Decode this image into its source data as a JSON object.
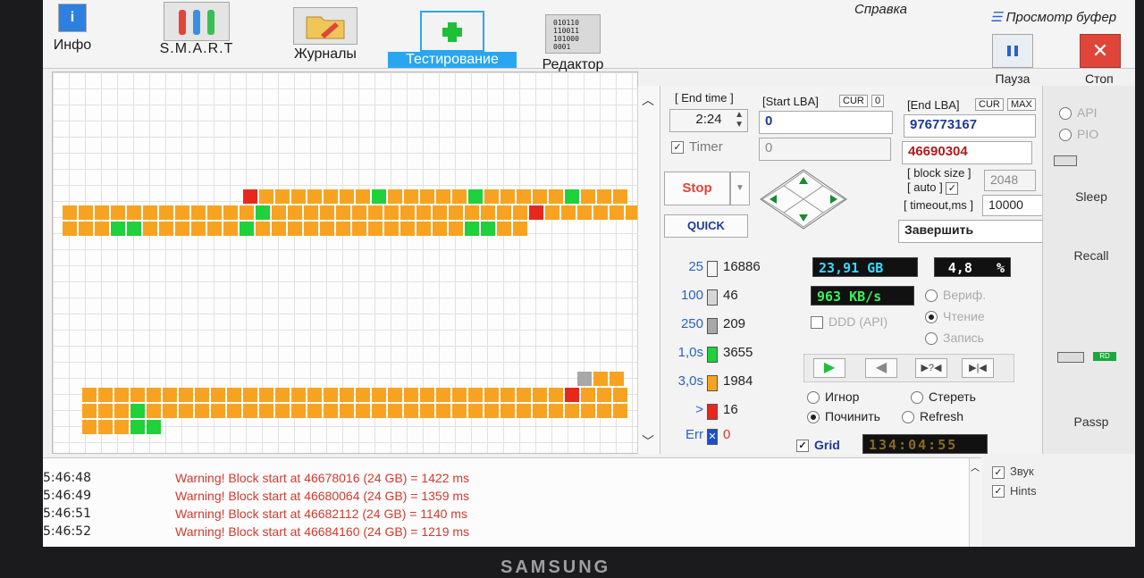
{
  "toolbar": {
    "info": "Инфо",
    "smart": "S.M.A.R.T",
    "journals": "Журналы",
    "testing": "Тестирование",
    "editor": "Редактор",
    "help_menu": "Справка",
    "view_menu": "Просмотр буфер",
    "pause": "Пауза",
    "stop": "Стоп",
    "editor_icon_text": [
      "010110",
      "110011",
      "101000",
      "0001"
    ]
  },
  "controls": {
    "end_time_label": "[ End time ]",
    "end_time_value": "2:24",
    "timer_label": "Timer",
    "start_lba_label": "[Start LBA]",
    "start_lba_cur": "CUR",
    "start_lba_zero": "0",
    "start_lba_value": "0",
    "start_lba_second": "0",
    "end_lba_label": "[End LBA]",
    "end_lba_cur": "CUR",
    "end_lba_max": "MAX",
    "end_lba_value": "976773167",
    "end_lba_second": "46690304",
    "stop_button": "Stop",
    "quick_button": "QUICK",
    "block_size_label": "[ block size ]",
    "auto_label": "[ auto ]",
    "block_size_value": "2048",
    "timeout_label": "[ timeout,ms ]",
    "timeout_value": "10000",
    "finish_select": "Завершить",
    "gb_value": "23,91 GB",
    "percent_value": "4,8",
    "percent_sign": "%",
    "speed_value": "963 KB/s",
    "verify": "Вериф.",
    "read": "Чтение",
    "write": "Запись",
    "ddd_api": "DDD (API)",
    "ignore": "Игнор",
    "erase": "Стереть",
    "repair": "Починить",
    "refresh": "Refresh",
    "grid": "Grid",
    "clock": "134:04:55",
    "play_btn": "▶",
    "back_btn": "◀",
    "skip_btn": "▶?◀",
    "end_btn": "▶|◀"
  },
  "legend": [
    {
      "threshold": "25",
      "count": "16886",
      "color": "#f6f6f6"
    },
    {
      "threshold": "100",
      "count": "46",
      "color": "#d6d6d6"
    },
    {
      "threshold": "250",
      "count": "209",
      "color": "#a8a8a8"
    },
    {
      "threshold": "1,0s",
      "count": "3655",
      "color": "#1fd13a"
    },
    {
      "threshold": "3,0s",
      "count": "1984",
      "color": "#f7a321"
    },
    {
      "threshold": ">",
      "count": "16",
      "color": "#e8281d"
    },
    {
      "threshold": "Err",
      "count": "0",
      "color": "#1b4fc9"
    }
  ],
  "side": {
    "api": "API",
    "pio": "PIO",
    "sleep": "Sleep",
    "recall": "Recall",
    "passp": "Passp",
    "rd": "RD"
  },
  "log": [
    {
      "time": "5:46:48",
      "msg": "Warning! Block start at 46678016 (24 GB)  = 1422 ms"
    },
    {
      "time": "5:46:49",
      "msg": "Warning! Block start at 46680064 (24 GB)  = 1359 ms"
    },
    {
      "time": "5:46:51",
      "msg": "Warning! Block start at 46682112 (24 GB)  = 1140 ms"
    },
    {
      "time": "5:46:52",
      "msg": "Warning! Block start at 46684160 (24 GB)  = 1219 ms"
    }
  ],
  "log_options": {
    "sound": "Звук",
    "hints": "Hints"
  },
  "bezel": "SAMSUNG",
  "colors": {
    "green": "#1fd13a",
    "orange": "#f7a321",
    "red": "#e8281d",
    "gray": "#a8a8a8"
  }
}
